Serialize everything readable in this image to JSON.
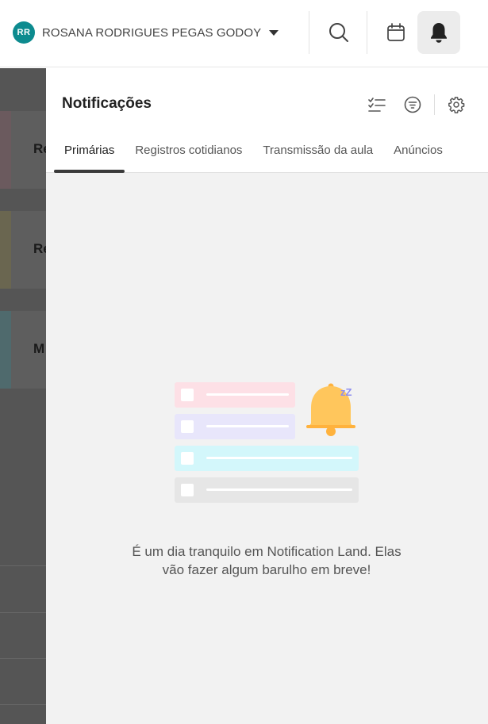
{
  "header": {
    "user": {
      "initials": "RR",
      "name": "ROSANA RODRIGUES PEGAS GODOY"
    },
    "icons": [
      "search-icon",
      "calendar-icon",
      "bell-icon"
    ]
  },
  "background": {
    "cards": [
      {
        "letters": "Re",
        "color": "#6b5a5e"
      },
      {
        "letters": "Re",
        "color": "#6a6650"
      },
      {
        "letters": "M",
        "color": "#4f6a6d"
      }
    ]
  },
  "notifications": {
    "title": "Notificações",
    "icons": [
      "mark-read-icon",
      "filter-icon",
      "settings-icon"
    ],
    "tabs": [
      {
        "label": "Primárias",
        "active": true
      },
      {
        "label": "Registros cotidianos",
        "active": false
      },
      {
        "label": "Transmissão da aula",
        "active": false
      },
      {
        "label": "Anúncios",
        "active": false
      }
    ],
    "empty_message": "É um dia tranquilo em Notification Land. Elas vão fazer algum barulho em breve!",
    "illustration": {
      "rows": [
        "#fde0e6",
        "#e8e6fb",
        "#d3f7fb",
        "#e6e6e6"
      ],
      "bell_color": "#ffc65c",
      "zz": "zZ"
    }
  },
  "colors": {
    "avatar": "#0d8b8f",
    "overlay": "#555555"
  }
}
